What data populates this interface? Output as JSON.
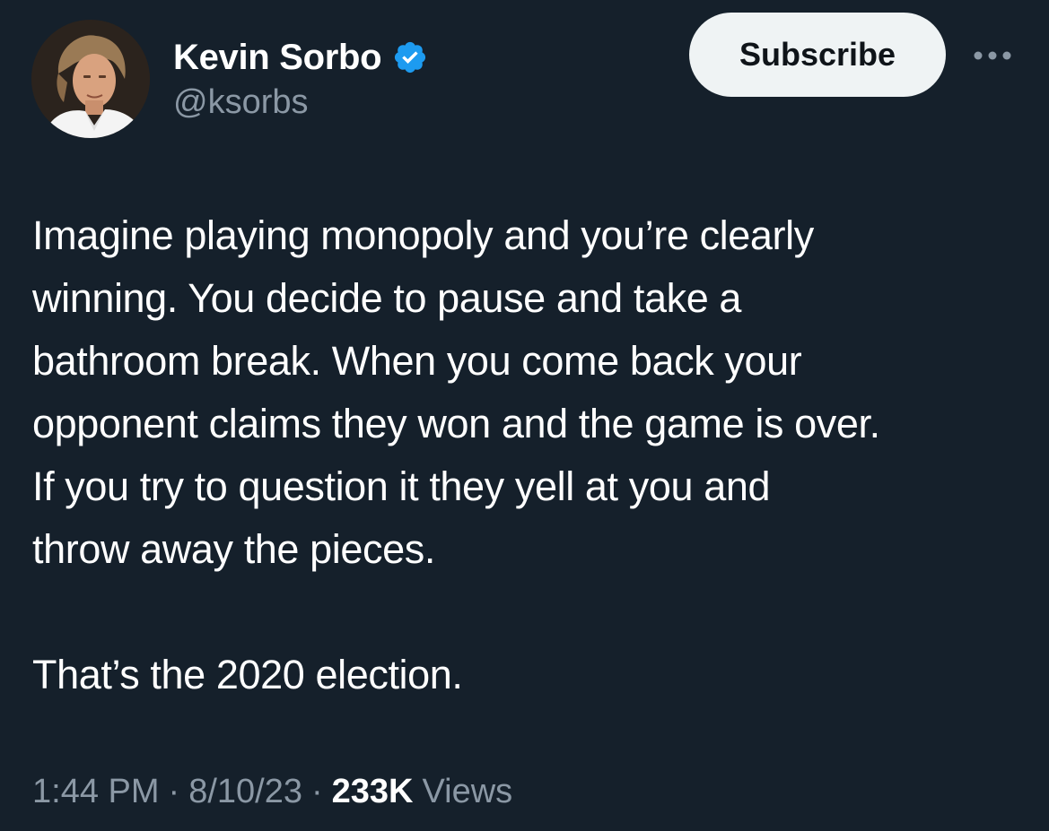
{
  "author": {
    "display_name": "Kevin Sorbo",
    "handle": "@ksorbs",
    "verified": true,
    "verified_icon": "verified-badge-icon",
    "avatar": "profile-photo"
  },
  "actions": {
    "subscribe_label": "Subscribe",
    "more_icon": "more-horizontal-icon"
  },
  "tweet": {
    "paragraphs": [
      "Imagine playing monopoly and you’re clearly\nwinning. You decide to pause and take a\nbathroom break. When you come back your\nopponent claims they won and the game is over.\nIf you try to question it they yell at you and\nthrow away the pieces.",
      "That’s the 2020 election."
    ]
  },
  "meta": {
    "time": "1:44 PM",
    "separator": "·",
    "date": "8/10/23",
    "views_count": "233K",
    "views_label": "Views"
  },
  "colors": {
    "background": "#15202b",
    "text_primary": "#ffffff",
    "text_secondary": "#8b98a5",
    "verified_blue": "#1d9bf0",
    "button_bg": "#eff3f4",
    "button_text": "#0f1419"
  }
}
